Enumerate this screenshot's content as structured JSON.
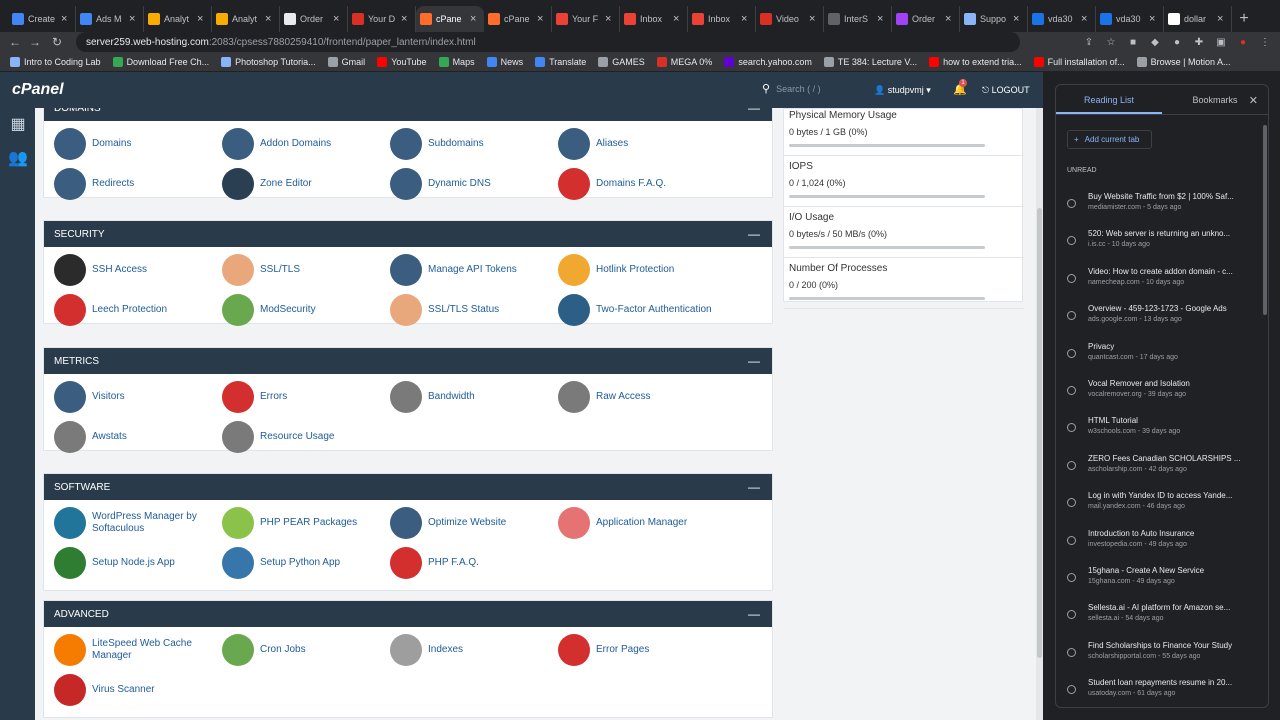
{
  "tabs": [
    {
      "title": "Create",
      "color": "#4285f4",
      "icon": "meta-icon"
    },
    {
      "title": "Ads M",
      "color": "#4285f4",
      "icon": "meta-icon"
    },
    {
      "title": "Analyt",
      "color": "#f9ab00",
      "icon": "analytics-icon"
    },
    {
      "title": "Analyt",
      "color": "#f9ab00",
      "icon": "analytics-icon"
    },
    {
      "title": "Order",
      "color": "#e8eaed",
      "icon": "doc-icon"
    },
    {
      "title": "Your D",
      "color": "#d93025",
      "icon": "namecheap-icon"
    },
    {
      "title": "cPane",
      "color": "#ff6c2c",
      "icon": "cpanel-icon",
      "active": true
    },
    {
      "title": "cPane",
      "color": "#ff6c2c",
      "icon": "cpanel-icon"
    },
    {
      "title": "Your F",
      "color": "#ea4335",
      "icon": "gmail-icon"
    },
    {
      "title": "Inbox",
      "color": "#ea4335",
      "icon": "gmail-icon"
    },
    {
      "title": "Inbox",
      "color": "#ea4335",
      "icon": "gmail-icon"
    },
    {
      "title": "Video",
      "color": "#d93025",
      "icon": "namecheap-icon"
    },
    {
      "title": "InterS",
      "color": "#5f6368",
      "icon": "page-icon"
    },
    {
      "title": "Order",
      "color": "#a142f4",
      "icon": "doc-icon"
    },
    {
      "title": "Suppo",
      "color": "#8ab4f8",
      "icon": "support-icon"
    },
    {
      "title": "vda30",
      "color": "#1a73e8",
      "icon": "cloud-icon"
    },
    {
      "title": "vda30",
      "color": "#1a73e8",
      "icon": "cloud-icon"
    },
    {
      "title": "dollar",
      "color": "#fff",
      "icon": "google-icon"
    }
  ],
  "address": {
    "domain": "server259.web-hosting.com",
    "path": ":2083/cpsess7880259410/frontend/paper_lantern/index.html"
  },
  "bookmarks": [
    {
      "label": "Intro to Coding Lab",
      "color": "#8ab4f8"
    },
    {
      "label": "Download Free Ch...",
      "color": "#34a853"
    },
    {
      "label": "Photoshop Tutoria...",
      "color": "#8ab4f8"
    },
    {
      "label": "Gmail",
      "color": "#9aa0a6"
    },
    {
      "label": "YouTube",
      "color": "#ff0000"
    },
    {
      "label": "Maps",
      "color": "#34a853"
    },
    {
      "label": "News",
      "color": "#4285f4"
    },
    {
      "label": "Translate",
      "color": "#4285f4"
    },
    {
      "label": "GAMES",
      "color": "#9aa0a6"
    },
    {
      "label": "MEGA 0%",
      "color": "#d93025"
    },
    {
      "label": "search.yahoo.com",
      "color": "#6001d2"
    },
    {
      "label": "TE 384: Lecture V...",
      "color": "#9aa0a6"
    },
    {
      "label": "how to extend tria...",
      "color": "#ff0000"
    },
    {
      "label": "Full installation of...",
      "color": "#ff0000"
    },
    {
      "label": "Browse | Motion A...",
      "color": "#9aa0a6"
    }
  ],
  "header": {
    "logo": "cPanel",
    "search_placeholder": "Search ( / )",
    "user": "studpvmj",
    "notifications": "1",
    "logout": "LOGOUT"
  },
  "groups": [
    {
      "title": "Domains",
      "items": [
        {
          "label": "Domains",
          "icon": "domains-icon",
          "color": "#3b5d7f"
        },
        {
          "label": "Addon Domains",
          "icon": "addon-domains-icon",
          "color": "#3b5d7f"
        },
        {
          "label": "Subdomains",
          "icon": "subdomains-icon",
          "color": "#3b5d7f"
        },
        {
          "label": "Aliases",
          "icon": "aliases-icon",
          "color": "#3b5d7f"
        },
        {
          "label": "Redirects",
          "icon": "redirects-icon",
          "color": "#3b5d7f"
        },
        {
          "label": "Zone Editor",
          "icon": "dns-icon",
          "color": "#2b3f52"
        },
        {
          "label": "Dynamic DNS",
          "icon": "dynamic-dns-icon",
          "color": "#3b5d7f"
        },
        {
          "label": "Domains F.A.Q.",
          "icon": "faq-icon",
          "color": "#d32f2f"
        }
      ]
    },
    {
      "title": "Security",
      "items": [
        {
          "label": "SSH Access",
          "icon": "ssh-icon",
          "color": "#2b2b2b"
        },
        {
          "label": "SSL/TLS",
          "icon": "certificate-icon",
          "color": "#e8a87c"
        },
        {
          "label": "Manage API Tokens",
          "icon": "api-icon",
          "color": "#3b5d7f"
        },
        {
          "label": "Hotlink Protection",
          "icon": "lock-link-icon",
          "color": "#f0a830"
        },
        {
          "label": "Leech Protection",
          "icon": "stop-hand-icon",
          "color": "#d32f2f"
        },
        {
          "label": "ModSecurity",
          "icon": "shield-icon",
          "color": "#6aa84f"
        },
        {
          "label": "SSL/TLS Status",
          "icon": "certificate-status-icon",
          "color": "#e8a87c"
        },
        {
          "label": "Two-Factor Authentication",
          "icon": "padlock-icon",
          "color": "#2c5f86"
        }
      ]
    },
    {
      "title": "Metrics",
      "items": [
        {
          "label": "Visitors",
          "icon": "visitors-icon",
          "color": "#3b5d7f"
        },
        {
          "label": "Errors",
          "icon": "error-icon",
          "color": "#d32f2f"
        },
        {
          "label": "Bandwidth",
          "icon": "gauge-icon",
          "color": "#7a7a7a"
        },
        {
          "label": "Raw Access",
          "icon": "raw-access-icon",
          "color": "#7a7a7a"
        },
        {
          "label": "Awstats",
          "icon": "awstats-icon",
          "color": "#7a7a7a"
        },
        {
          "label": "Resource Usage",
          "icon": "resource-usage-icon",
          "color": "#7a7a7a"
        }
      ]
    },
    {
      "title": "Software",
      "items": [
        {
          "label": "WordPress Manager by Softaculous",
          "icon": "wordpress-icon",
          "color": "#21759b"
        },
        {
          "label": "PHP PEAR Packages",
          "icon": "pear-icon",
          "color": "#8bc34a"
        },
        {
          "label": "Optimize Website",
          "icon": "optimize-icon",
          "color": "#3b5d7f"
        },
        {
          "label": "Application Manager",
          "icon": "app-manager-icon",
          "color": "#e57373"
        },
        {
          "label": "Setup Node.js App",
          "icon": "nodejs-icon",
          "color": "#2e7d32"
        },
        {
          "label": "Setup Python App",
          "icon": "python-icon",
          "color": "#3776ab"
        },
        {
          "label": "PHP F.A.Q.",
          "icon": "php-faq-icon",
          "color": "#d32f2f"
        }
      ]
    },
    {
      "title": "Advanced",
      "items": [
        {
          "label": "LiteSpeed Web Cache Manager",
          "icon": "litespeed-icon",
          "color": "#f57c00"
        },
        {
          "label": "Cron Jobs",
          "icon": "cron-icon",
          "color": "#6aa84f"
        },
        {
          "label": "Indexes",
          "icon": "indexes-icon",
          "color": "#9e9e9e"
        },
        {
          "label": "Error Pages",
          "icon": "error-pages-icon",
          "color": "#d32f2f"
        },
        {
          "label": "Virus Scanner",
          "icon": "virus-icon",
          "color": "#c62828"
        }
      ]
    }
  ],
  "stats": [
    {
      "title": "Physical Memory Usage",
      "value": "0 bytes / 1 GB   (0%)"
    },
    {
      "title": "IOPS",
      "value": "0 / 1,024   (0%)"
    },
    {
      "title": "I/O Usage",
      "value": "0 bytes/s / 50 MB/s   (0%)"
    },
    {
      "title": "Number Of Processes",
      "value": "0 / 200   (0%)"
    }
  ],
  "reading_list": {
    "tab_reading": "Reading List",
    "tab_bookmarks": "Bookmarks",
    "add": "Add current tab",
    "unread": "UNREAD",
    "items": [
      {
        "title": "Buy Website Traffic from $2 | 100% Saf...",
        "sub": "mediamister.com - 5 days ago"
      },
      {
        "title": "520: Web server is returning an unkno...",
        "sub": "i.is.cc - 10 days ago"
      },
      {
        "title": "Video: How to create addon domain - c...",
        "sub": "namecheap.com - 10 days ago"
      },
      {
        "title": "Overview - 459-123-1723 - Google Ads",
        "sub": "ads.google.com - 13 days ago"
      },
      {
        "title": "Privacy",
        "sub": "quantcast.com - 17 days ago"
      },
      {
        "title": "Vocal Remover and Isolation",
        "sub": "vocalremover.org - 39 days ago"
      },
      {
        "title": "HTML Tutorial",
        "sub": "w3schools.com - 39 days ago"
      },
      {
        "title": "ZERO Fees Canadian SCHOLARSHIPS ...",
        "sub": "ascholarship.com - 42 days ago"
      },
      {
        "title": "Log in with Yandex ID to access Yande...",
        "sub": "mail.yandex.com - 46 days ago"
      },
      {
        "title": "Introduction to Auto Insurance",
        "sub": "investopedia.com - 49 days ago"
      },
      {
        "title": "15ghana - Create A New Service",
        "sub": "15ghana.com - 49 days ago"
      },
      {
        "title": "Sellesta.ai - AI platform for Amazon se...",
        "sub": "sellesta.ai - 54 days ago"
      },
      {
        "title": "Find Scholarships to Finance Your Study",
        "sub": "scholarshipportal.com - 55 days ago"
      },
      {
        "title": "Student loan repayments resume in 20...",
        "sub": "usatoday.com - 61 days ago"
      }
    ]
  }
}
